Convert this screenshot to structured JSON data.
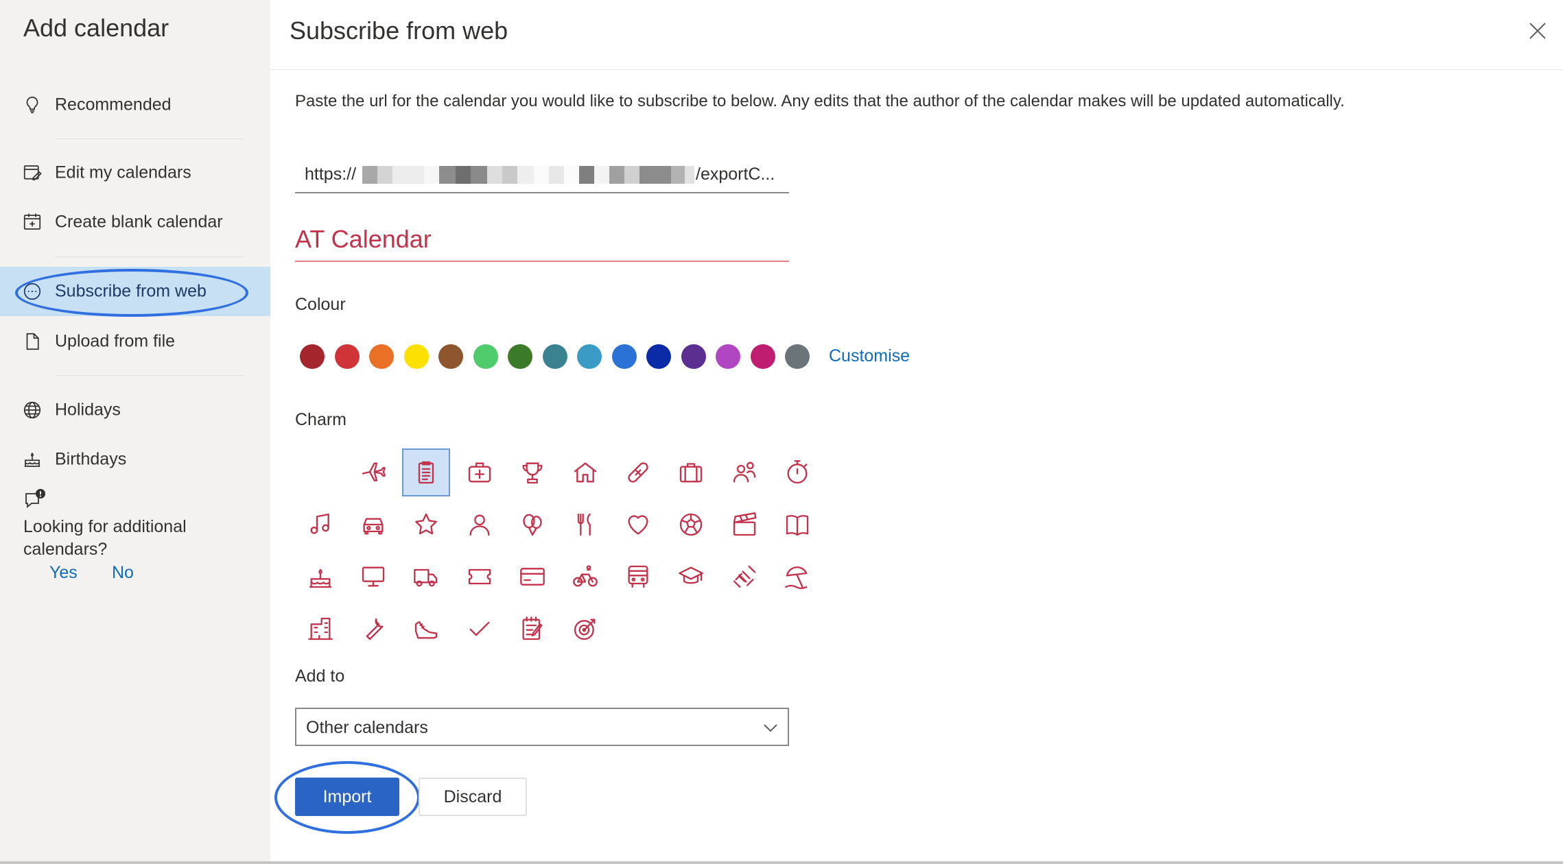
{
  "sidebar": {
    "title": "Add calendar",
    "items": [
      {
        "label": "Recommended",
        "icon": "lightbulb-icon"
      },
      {
        "label": "Edit my calendars",
        "icon": "edit-calendar-icon"
      },
      {
        "label": "Create blank calendar",
        "icon": "add-calendar-icon"
      },
      {
        "label": "Subscribe from web",
        "icon": "web-subscribe-icon",
        "selected": true
      },
      {
        "label": "Upload from file",
        "icon": "file-icon"
      },
      {
        "label": "Holidays",
        "icon": "globe-icon"
      },
      {
        "label": "Birthdays",
        "icon": "cake-icon"
      }
    ],
    "feedback": {
      "icon": "feedback-icon",
      "question": "Looking for additional calendars?",
      "yes": "Yes",
      "no": "No"
    }
  },
  "main": {
    "title": "Subscribe from web",
    "close_icon": "close-icon",
    "instructions": "Paste the url for the calendar you would like to subscribe to below. Any edits that the author of the calendar makes will be updated automatically.",
    "url": {
      "prefix": "https://",
      "suffix": "/exportC..."
    },
    "calendar_name": "AT Calendar",
    "colour_label": "Colour",
    "colours": [
      "#a4262c",
      "#d13438",
      "#ea7025",
      "#fce100",
      "#8e562e",
      "#4fcb6c",
      "#3b7a28",
      "#3b8290",
      "#3a9bc4",
      "#2b72d6",
      "#0b2aa8",
      "#5c2e91",
      "#b146c2",
      "#bf1d6f",
      "#6b7478"
    ],
    "customise": "Customise",
    "charm_label": "Charm",
    "charm_color": "#c4314b",
    "charms": [
      "none",
      "airplane",
      "clipboard",
      "first-aid",
      "trophy",
      "home",
      "bandage",
      "briefcase",
      "people",
      "stopwatch",
      "music",
      "car",
      "star",
      "person",
      "balloons",
      "cutlery",
      "heart",
      "football",
      "clapperboard",
      "book",
      "cake",
      "monitor",
      "truck",
      "ticket",
      "credit-card",
      "bike",
      "bus",
      "graduation-cap",
      "dumbbell",
      "beach-umbrella",
      "building",
      "wrench",
      "sneaker",
      "checkmark",
      "notepad",
      "target"
    ],
    "selected_charm": "clipboard",
    "add_to_label": "Add to",
    "add_to_value": "Other calendars",
    "import_button": "Import",
    "discard_button": "Discard"
  }
}
